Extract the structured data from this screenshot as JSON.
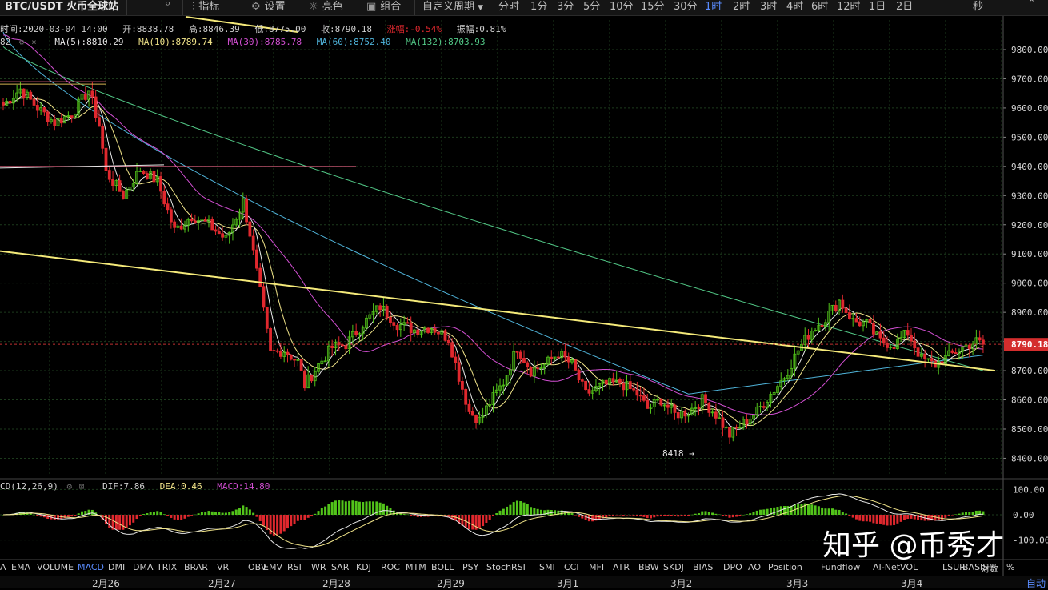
{
  "toolbar": {
    "symbol": "BTC/USDT 火币全球站",
    "items": [
      {
        "label": "指标",
        "icon": "indicator-icon"
      },
      {
        "label": "设置",
        "icon": "gear-icon"
      },
      {
        "label": "亮色",
        "icon": "light-icon"
      },
      {
        "label": "组合",
        "icon": "layout-icon"
      }
    ],
    "custom_period": "自定义周期",
    "periods": [
      "分时",
      "1分",
      "3分",
      "5分",
      "10分",
      "15分",
      "30分",
      "1时",
      "2时",
      "3时",
      "4时",
      "6时",
      "12时",
      "1日",
      "2日"
    ],
    "active_period": "1时",
    "right_label": "秒"
  },
  "ohlc": {
    "time_label": "时间:2020-03-04 14:00",
    "open_label": "开:8838.78",
    "high_label": "高:8846.39",
    "low_label": "低:8775.00",
    "close_label": "收:8790.18",
    "change_label": "涨幅:-0.54%",
    "amplitude_label": "振幅:0.81%"
  },
  "ma_legend": {
    "prefix": "82",
    "items": [
      {
        "label": "MA(5):8810.29",
        "color": "#e8e8e8"
      },
      {
        "label": "MA(10):8789.74",
        "color": "#f2e58a"
      },
      {
        "label": "MA(30):8785.78",
        "color": "#d24fd2"
      },
      {
        "label": "MA(60):8752.40",
        "color": "#4fb3d9"
      },
      {
        "label": "MA(132):8703.93",
        "color": "#52c987"
      }
    ]
  },
  "macd_legend": {
    "name": "CD(12,26,9)",
    "dif": "DIF:7.86",
    "dea": "DEA:0.46",
    "macd": "MACD:14.80"
  },
  "indicators": [
    "A",
    "EMA",
    "VOLUME",
    "MACD",
    "DMI",
    "DMA",
    "TRIX",
    "BRAR",
    "VR",
    "OBV",
    "EMV",
    "RSI",
    "WR",
    "SAR",
    "KDJ",
    "ROC",
    "MTM",
    "BOLL",
    "PSY",
    "StochRSI",
    "SMI",
    "CCI",
    "MFI",
    "ATR",
    "BBW",
    "SKDJ",
    "BIAS",
    "DPO",
    "AO",
    "Position",
    "Fundflow",
    "AI-NetVOL",
    "LSUR",
    "BASIS"
  ],
  "active_indicator": "MACD",
  "dates": [
    "2月26",
    "2月27",
    "2月28",
    "2月29",
    "3月1",
    "3月2",
    "3月3",
    "3月4"
  ],
  "scale_labels": {
    "log": "对数",
    "pct": "%",
    "auto": "自动"
  },
  "low_marker": "8418 →",
  "current_price": "8790.18",
  "watermark": "知乎 @币秀才",
  "colors": {
    "up": "#52c41a",
    "down": "#e0282e",
    "active": "#5a8cff",
    "trendline": "#f5ea7a"
  },
  "chart_data": {
    "type": "candlestick",
    "price_axis": {
      "ticks": [
        9800,
        9700,
        9600,
        9500,
        9400,
        9300,
        9200,
        9100,
        9000,
        8900,
        8800,
        8700,
        8600,
        8500,
        8400
      ],
      "min": 8330,
      "max": 9900
    },
    "macd_axis": {
      "ticks": [
        100,
        0,
        -100
      ]
    },
    "anchors": [
      [
        0,
        9610
      ],
      [
        5,
        9665
      ],
      [
        10,
        9600
      ],
      [
        15,
        9550
      ],
      [
        20,
        9580
      ],
      [
        25,
        9660
      ],
      [
        28,
        9540
      ],
      [
        30,
        9380
      ],
      [
        35,
        9300
      ],
      [
        40,
        9390
      ],
      [
        45,
        9350
      ],
      [
        50,
        9180
      ],
      [
        55,
        9230
      ],
      [
        60,
        9200
      ],
      [
        65,
        9150
      ],
      [
        70,
        9280
      ],
      [
        72,
        9170
      ],
      [
        75,
        8970
      ],
      [
        78,
        8760
      ],
      [
        82,
        8770
      ],
      [
        86,
        8730
      ],
      [
        88,
        8650
      ],
      [
        92,
        8720
      ],
      [
        96,
        8780
      ],
      [
        100,
        8790
      ],
      [
        105,
        8860
      ],
      [
        110,
        8920
      ],
      [
        115,
        8860
      ],
      [
        120,
        8840
      ],
      [
        125,
        8850
      ],
      [
        130,
        8810
      ],
      [
        133,
        8680
      ],
      [
        136,
        8560
      ],
      [
        139,
        8530
      ],
      [
        142,
        8590
      ],
      [
        146,
        8660
      ],
      [
        150,
        8780
      ],
      [
        154,
        8700
      ],
      [
        158,
        8720
      ],
      [
        162,
        8760
      ],
      [
        166,
        8720
      ],
      [
        170,
        8620
      ],
      [
        175,
        8650
      ],
      [
        180,
        8660
      ],
      [
        185,
        8620
      ],
      [
        188,
        8570
      ],
      [
        192,
        8600
      ],
      [
        196,
        8550
      ],
      [
        200,
        8560
      ],
      [
        204,
        8600
      ],
      [
        208,
        8550
      ],
      [
        212,
        8480
      ],
      [
        216,
        8520
      ],
      [
        220,
        8560
      ],
      [
        224,
        8620
      ],
      [
        228,
        8680
      ],
      [
        232,
        8770
      ],
      [
        236,
        8840
      ],
      [
        240,
        8880
      ],
      [
        244,
        8940
      ],
      [
        248,
        8870
      ],
      [
        252,
        8860
      ],
      [
        256,
        8800
      ],
      [
        260,
        8790
      ],
      [
        264,
        8830
      ],
      [
        268,
        8740
      ],
      [
        272,
        8720
      ],
      [
        276,
        8750
      ],
      [
        280,
        8780
      ],
      [
        284,
        8800
      ],
      [
        286,
        8790
      ]
    ],
    "current": 8790.18,
    "low_mark": 8418
  }
}
